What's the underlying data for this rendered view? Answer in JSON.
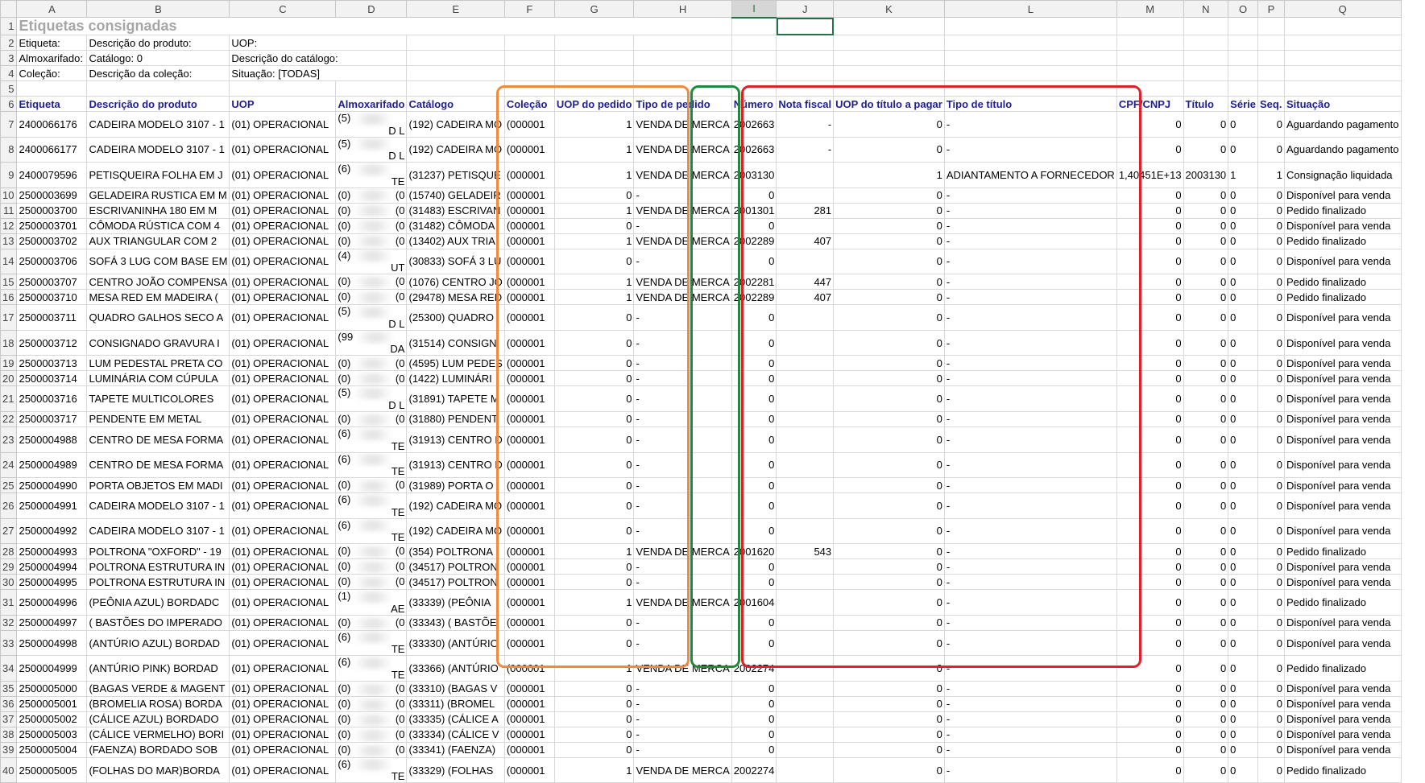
{
  "sheet": {
    "columns": [
      "A",
      "B",
      "C",
      "D",
      "E",
      "F",
      "G",
      "H",
      "I",
      "J",
      "K",
      "L",
      "M",
      "N",
      "O",
      "P",
      "Q"
    ],
    "selected_column": "I",
    "title": "Etiquetas consignadas",
    "filters": [
      [
        "Etiqueta:",
        "Descrição do produto:",
        "UOP:"
      ],
      [
        "Almoxarifado:",
        "Catálogo: 0",
        "Descrição do catálogo:"
      ],
      [
        "Coleção:",
        "Descrição da coleção:",
        "Situação: [TODAS]"
      ]
    ],
    "headers": [
      "Etiqueta",
      "Descrição do produto",
      "UOP",
      "Almoxarifado",
      "Catálogo",
      "Coleção",
      "UOP do pedido",
      "Tipo de pedido",
      "Número",
      "Nota fiscal",
      "UOP do título a pagar",
      "Tipo de título",
      "CPF/CNPJ",
      "Título",
      "Série",
      "Seq.",
      "Situação"
    ],
    "rows": [
      [
        "2400066176",
        "CADEIRA MODELO 3107 - 1",
        "(01) OPERACIONAL",
        "(5)",
        "D L",
        "(192) CADEIRA MO",
        "(000001",
        "1",
        "VENDA DE MERCA",
        "2002663",
        "-",
        "0",
        "-",
        "0",
        "0",
        "0",
        "0",
        "Aguardando pagamento"
      ],
      [
        "2400066177",
        "CADEIRA MODELO 3107 - 1",
        "(01) OPERACIONAL",
        "(5)",
        "D L",
        "(192) CADEIRA MO",
        "(000001",
        "1",
        "VENDA DE MERCA",
        "2002663",
        "-",
        "0",
        "-",
        "0",
        "0",
        "0",
        "0",
        "Aguardando pagamento"
      ],
      [
        "2400079596",
        "PETISQUEIRA FOLHA EM J",
        "(01) OPERACIONAL",
        "(6)",
        "TE",
        "(31237) PETISQUE",
        "(000001",
        "1",
        "VENDA DE MERCA",
        "2003130",
        "",
        "1",
        "ADIANTAMENTO A FORNECEDOR",
        "1,40451E+13",
        "2003130",
        "1",
        "1",
        "Consignação liquidada"
      ],
      [
        "2500003699",
        "GELADEIRA RUSTICA EM M",
        "(01) OPERACIONAL",
        "(0)",
        "(0",
        "(15740) GELADEIR",
        "(000001",
        "0",
        "-",
        "0",
        "",
        "0",
        "-",
        "0",
        "0",
        "0",
        "0",
        "Disponível para venda"
      ],
      [
        "2500003700",
        "ESCRIVANINHA 180 EM M",
        "(01) OPERACIONAL",
        "(0)",
        "(0",
        "(31483) ESCRIVAN",
        "(000001",
        "1",
        "VENDA DE MERCA",
        "2001301",
        "281",
        "0",
        "-",
        "0",
        "0",
        "0",
        "0",
        "Pedido finalizado"
      ],
      [
        "2500003701",
        "CÔMODA RÚSTICA COM 4",
        "(01) OPERACIONAL",
        "(0)",
        "(0",
        "(31482) CÔMODA",
        "(000001",
        "0",
        "-",
        "0",
        "",
        "0",
        "-",
        "0",
        "0",
        "0",
        "0",
        "Disponível para venda"
      ],
      [
        "2500003702",
        "AUX TRIANGULAR COM 2",
        "(01) OPERACIONAL",
        "(0)",
        "(0",
        "(13402) AUX TRIA",
        "(000001",
        "1",
        "VENDA DE MERCA",
        "2002289",
        "407",
        "0",
        "-",
        "0",
        "0",
        "0",
        "0",
        "Pedido finalizado"
      ],
      [
        "2500003706",
        "SOFÁ 3 LUG COM BASE EM",
        "(01) OPERACIONAL",
        "(4)",
        "UT",
        "(30833) SOFÁ 3 LU",
        "(000001",
        "0",
        "-",
        "0",
        "",
        "0",
        "-",
        "0",
        "0",
        "0",
        "0",
        "Disponível para venda"
      ],
      [
        "2500003707",
        "CENTRO JOÃO COMPENSA",
        "(01) OPERACIONAL",
        "(0)",
        "(0",
        "(1076) CENTRO JO",
        "(000001",
        "1",
        "VENDA DE MERCA",
        "2002281",
        "447",
        "0",
        "-",
        "0",
        "0",
        "0",
        "0",
        "Pedido finalizado"
      ],
      [
        "2500003710",
        "MESA RED EM MADEIRA (",
        "(01) OPERACIONAL",
        "(0)",
        "(0",
        "(29478) MESA RED",
        "(000001",
        "1",
        "VENDA DE MERCA",
        "2002289",
        "407",
        "0",
        "-",
        "0",
        "0",
        "0",
        "0",
        "Pedido finalizado"
      ],
      [
        "2500003711",
        "QUADRO GALHOS SECO A",
        "(01) OPERACIONAL",
        "(5)",
        "D L",
        "(25300) QUADRO",
        "(000001",
        "0",
        "-",
        "0",
        "",
        "0",
        "-",
        "0",
        "0",
        "0",
        "0",
        "Disponível para venda"
      ],
      [
        "2500003712",
        "CONSIGNADO GRAVURA I",
        "(01) OPERACIONAL",
        "(99",
        "DA",
        "(31514) CONSIGN",
        "(000001",
        "0",
        "-",
        "0",
        "",
        "0",
        "-",
        "0",
        "0",
        "0",
        "0",
        "Disponível para venda"
      ],
      [
        "2500003713",
        "LUM PEDESTAL PRETA CO",
        "(01) OPERACIONAL",
        "(0)",
        "(0",
        "(4595) LUM PEDES",
        "(000001",
        "0",
        "-",
        "0",
        "",
        "0",
        "-",
        "0",
        "0",
        "0",
        "0",
        "Disponível para venda"
      ],
      [
        "2500003714",
        "LUMINÁRIA COM CÚPULA",
        "(01) OPERACIONAL",
        "(0)",
        "(0",
        "(1422) LUMINÁRI",
        "(000001",
        "0",
        "-",
        "0",
        "",
        "0",
        "-",
        "0",
        "0",
        "0",
        "0",
        "Disponível para venda"
      ],
      [
        "2500003716",
        "TAPETE MULTICOLORES",
        "(01) OPERACIONAL",
        "(5)",
        "D L",
        "(31891) TAPETE M",
        "(000001",
        "0",
        "-",
        "0",
        "",
        "0",
        "-",
        "0",
        "0",
        "0",
        "0",
        "Disponível para venda"
      ],
      [
        "2500003717",
        "PENDENTE EM METAL",
        "(01) OPERACIONAL",
        "(0)",
        "(0",
        "(31880) PENDENT",
        "(000001",
        "0",
        "-",
        "0",
        "",
        "0",
        "-",
        "0",
        "0",
        "0",
        "0",
        "Disponível para venda"
      ],
      [
        "2500004988",
        "CENTRO DE MESA FORMA",
        "(01) OPERACIONAL",
        "(6)",
        "TE",
        "(31913) CENTRO D",
        "(000001",
        "0",
        "-",
        "0",
        "",
        "0",
        "-",
        "0",
        "0",
        "0",
        "0",
        "Disponível para venda"
      ],
      [
        "2500004989",
        "CENTRO DE MESA FORMA",
        "(01) OPERACIONAL",
        "(6)",
        "TE",
        "(31913) CENTRO D",
        "(000001",
        "0",
        "-",
        "0",
        "",
        "0",
        "-",
        "0",
        "0",
        "0",
        "0",
        "Disponível para venda"
      ],
      [
        "2500004990",
        "PORTA OBJETOS EM MADI",
        "(01) OPERACIONAL",
        "(0)",
        "(0",
        "(31989) PORTA O",
        "(000001",
        "0",
        "-",
        "0",
        "",
        "0",
        "-",
        "0",
        "0",
        "0",
        "0",
        "Disponível para venda"
      ],
      [
        "2500004991",
        "CADEIRA MODELO 3107 - 1",
        "(01) OPERACIONAL",
        "(6)",
        "TE",
        "(192) CADEIRA MO",
        "(000001",
        "0",
        "-",
        "0",
        "",
        "0",
        "-",
        "0",
        "0",
        "0",
        "0",
        "Disponível para venda"
      ],
      [
        "2500004992",
        "CADEIRA MODELO 3107 - 1",
        "(01) OPERACIONAL",
        "(6)",
        "TE",
        "(192) CADEIRA MO",
        "(000001",
        "0",
        "-",
        "0",
        "",
        "0",
        "-",
        "0",
        "0",
        "0",
        "0",
        "Disponível para venda"
      ],
      [
        "2500004993",
        "POLTRONA \"OXFORD\" - 19",
        "(01) OPERACIONAL",
        "(0)",
        "(0",
        "(354) POLTRONA",
        "(000001",
        "1",
        "VENDA DE MERCA",
        "2001620",
        "543",
        "0",
        "-",
        "0",
        "0",
        "0",
        "0",
        "Pedido finalizado"
      ],
      [
        "2500004994",
        "POLTRONA ESTRUTURA IN",
        "(01) OPERACIONAL",
        "(0)",
        "(0",
        "(34517) POLTRON",
        "(000001",
        "0",
        "-",
        "0",
        "",
        "0",
        "-",
        "0",
        "0",
        "0",
        "0",
        "Disponível para venda"
      ],
      [
        "2500004995",
        "POLTRONA ESTRUTURA IN",
        "(01) OPERACIONAL",
        "(0)",
        "(0",
        "(34517) POLTRON",
        "(000001",
        "0",
        "-",
        "0",
        "",
        "0",
        "-",
        "0",
        "0",
        "0",
        "0",
        "Disponível para venda"
      ],
      [
        "2500004996",
        "(PEÔNIA AZUL) BORDADC",
        "(01) OPERACIONAL",
        "(1)",
        "AE",
        "(33339) (PEÔNIA",
        "(000001",
        "1",
        "VENDA DE MERCA",
        "2001604",
        "",
        "0",
        "-",
        "0",
        "0",
        "0",
        "0",
        "Pedido finalizado"
      ],
      [
        "2500004997",
        "( BASTÕES DO IMPERADO",
        "(01) OPERACIONAL",
        "(0)",
        "(0",
        "(33343) ( BASTÕE",
        "(000001",
        "0",
        "-",
        "0",
        "",
        "0",
        "-",
        "0",
        "0",
        "0",
        "0",
        "Disponível para venda"
      ],
      [
        "2500004998",
        "(ANTÚRIO AZUL) BORDAD",
        "(01) OPERACIONAL",
        "(6)",
        "TE",
        "(33330) (ANTÚRIO",
        "(000001",
        "0",
        "-",
        "0",
        "",
        "0",
        "-",
        "0",
        "0",
        "0",
        "0",
        "Disponível para venda"
      ],
      [
        "2500004999",
        "(ANTÚRIO PINK) BORDAD",
        "(01) OPERACIONAL",
        "(6)",
        "TE",
        "(33366) (ANTÚRIO",
        "(000001",
        "1",
        "VENDA DE MERCA",
        "2002274",
        "",
        "0",
        "-",
        "0",
        "0",
        "0",
        "0",
        "Pedido finalizado"
      ],
      [
        "2500005000",
        "(BAGAS VERDE & MAGENT",
        "(01) OPERACIONAL",
        "(0)",
        "(0",
        "(33310) (BAGAS V",
        "(000001",
        "0",
        "-",
        "0",
        "",
        "0",
        "-",
        "0",
        "0",
        "0",
        "0",
        "Disponível para venda"
      ],
      [
        "2500005001",
        "(BROMELIA ROSA) BORDA",
        "(01) OPERACIONAL",
        "(0)",
        "(0",
        "(33311) (BROMEL",
        "(000001",
        "0",
        "-",
        "0",
        "",
        "0",
        "-",
        "0",
        "0",
        "0",
        "0",
        "Disponível para venda"
      ],
      [
        "2500005002",
        "(CÁLICE AZUL) BORDADO",
        "(01) OPERACIONAL",
        "(0)",
        "(0",
        "(33335) (CÁLICE A",
        "(000001",
        "0",
        "-",
        "0",
        "",
        "0",
        "-",
        "0",
        "0",
        "0",
        "0",
        "Disponível para venda"
      ],
      [
        "2500005003",
        "(CÁLICE VERMELHO) BORI",
        "(01) OPERACIONAL",
        "(0)",
        "(0",
        "(33334) (CÁLICE V",
        "(000001",
        "0",
        "-",
        "0",
        "",
        "0",
        "-",
        "0",
        "0",
        "0",
        "0",
        "Disponível para venda"
      ],
      [
        "2500005004",
        "(FAENZA)  BORDADO SOB",
        "(01) OPERACIONAL",
        "(0)",
        "(0",
        "(33341) (FAENZA)",
        "(000001",
        "0",
        "-",
        "0",
        "",
        "0",
        "-",
        "0",
        "0",
        "0",
        "0",
        "Disponível para venda"
      ],
      [
        "2500005005",
        "(FOLHAS DO MAR)BORDA",
        "(01) OPERACIONAL",
        "(6)",
        "TE",
        "(33329) (FOLHAS",
        "(000001",
        "1",
        "VENDA DE MERCA",
        "2002274",
        "",
        "0",
        "-",
        "0",
        "0",
        "0",
        "0",
        "Pedido finalizado"
      ]
    ]
  },
  "highlights": {
    "orange": "#f08a3c",
    "green": "#1e8a3e",
    "red": "#e0202a"
  }
}
